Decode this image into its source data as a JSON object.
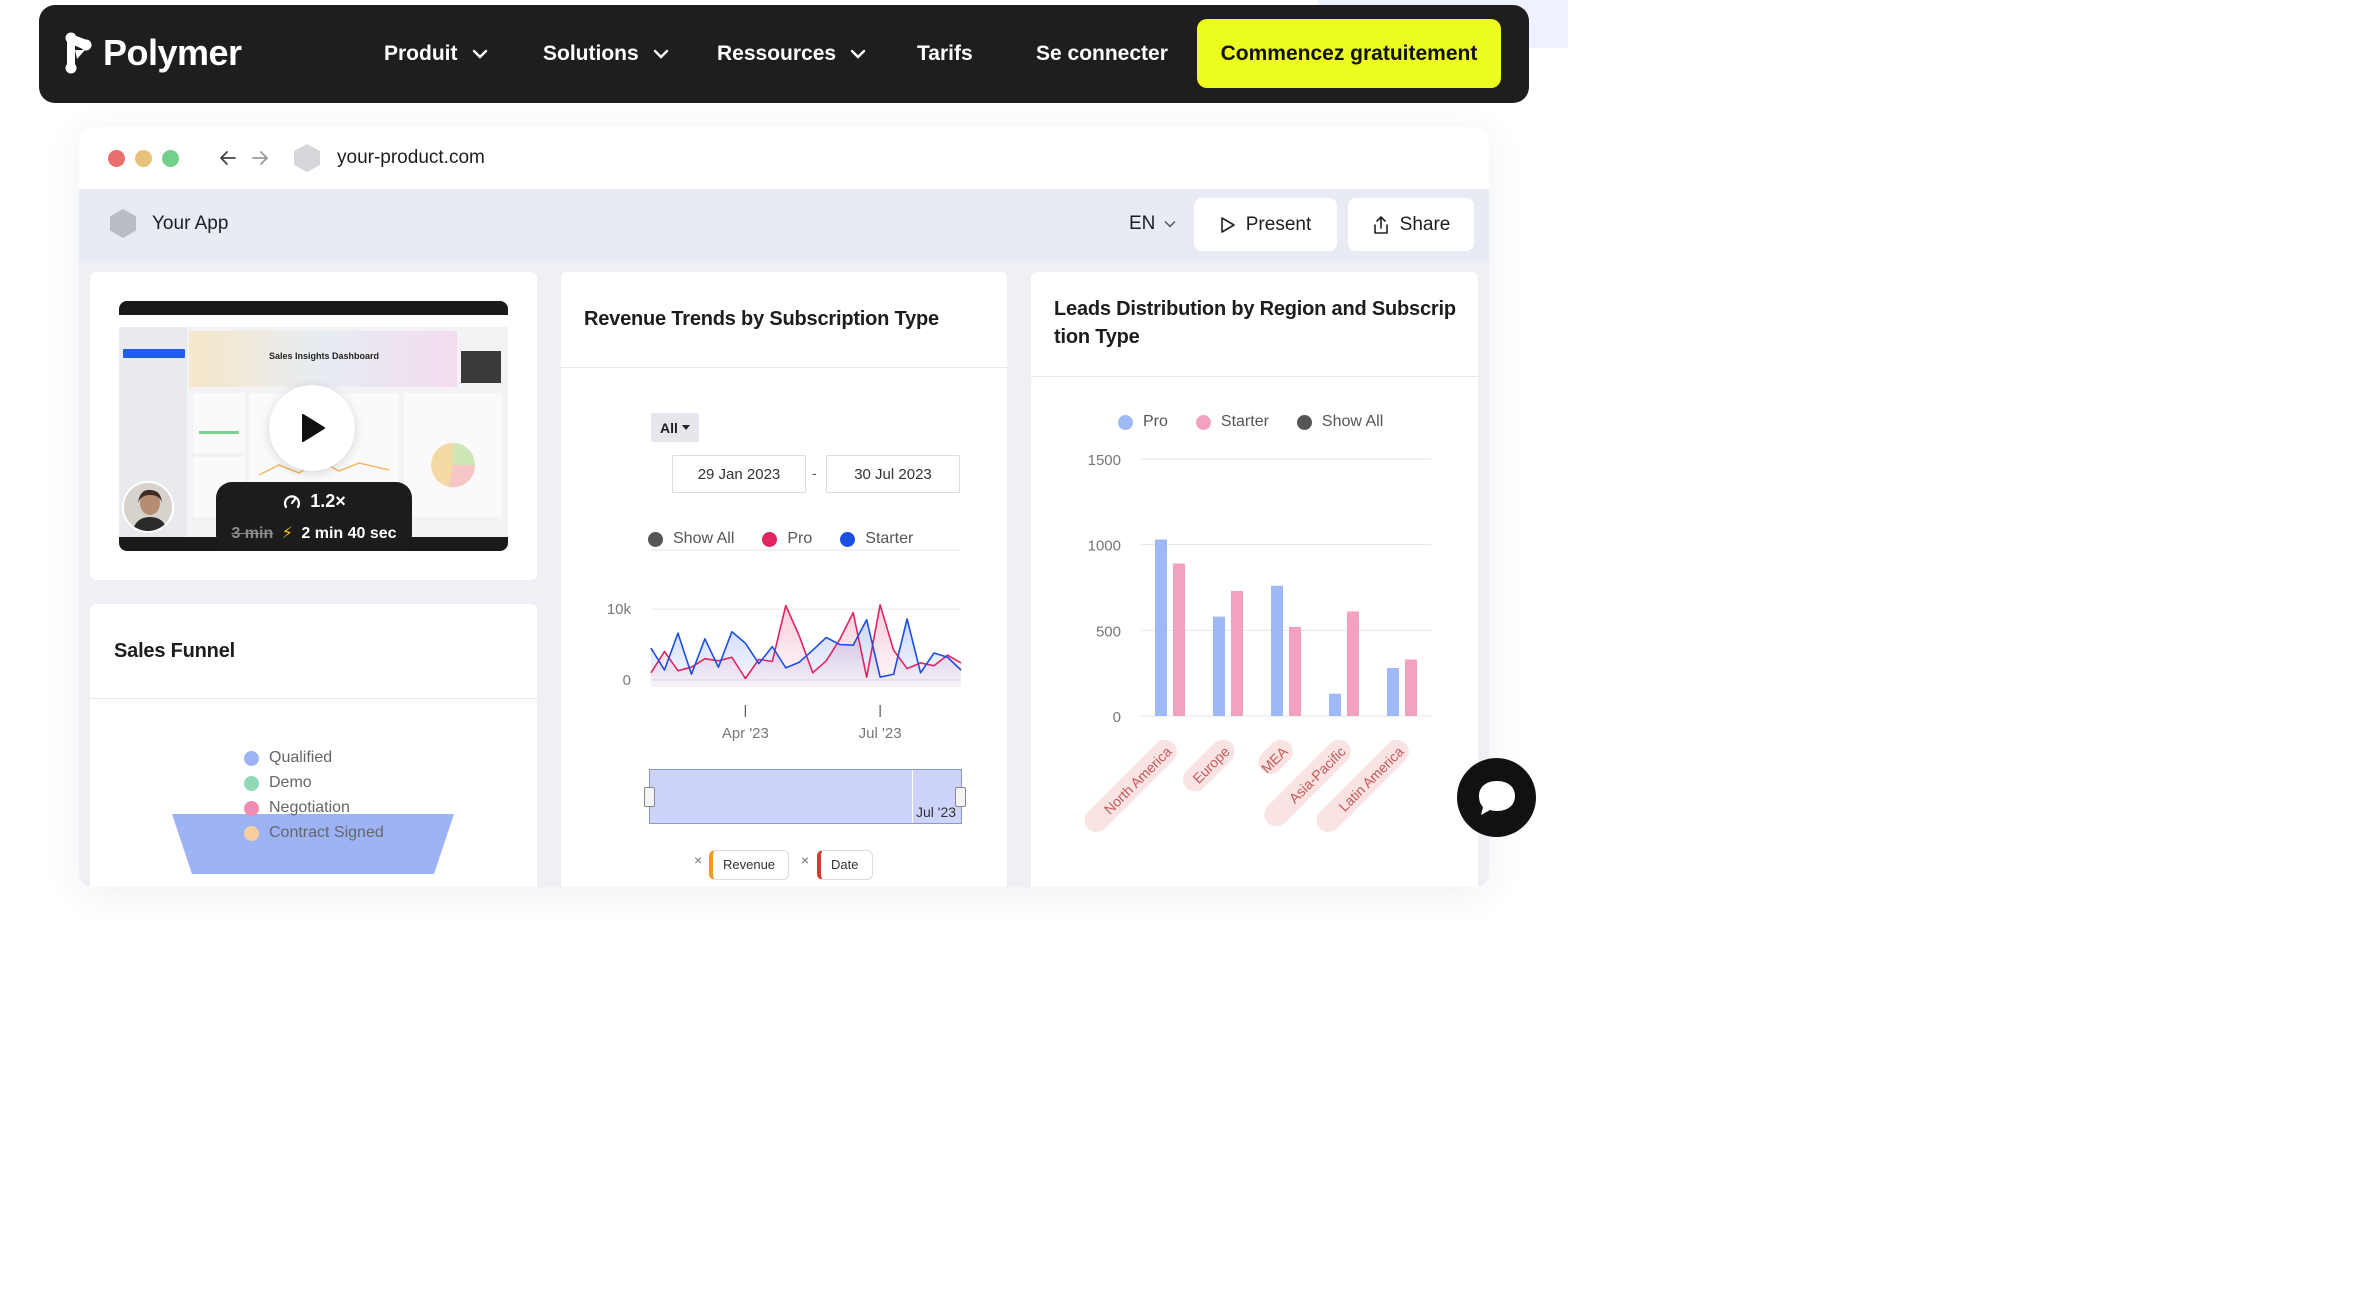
{
  "nav": {
    "brand": "Polymer",
    "items": [
      {
        "label": "Produit",
        "dropdown": true
      },
      {
        "label": "Solutions",
        "dropdown": true
      },
      {
        "label": "Ressources",
        "dropdown": true
      },
      {
        "label": "Tarifs",
        "dropdown": false
      },
      {
        "label": "Se connecter",
        "dropdown": false
      }
    ],
    "cta": "Commencez gratuitement"
  },
  "browser": {
    "url": "your-product.com"
  },
  "app": {
    "name": "Your App",
    "language": "EN",
    "present_label": "Present",
    "share_label": "Share"
  },
  "video": {
    "thumbnail_title": "Sales Insights Dashboard",
    "speed": "1.2×",
    "original_duration": "3 min",
    "new_duration": "2 min 40 sec"
  },
  "revenue_card": {
    "title": "Revenue Trends by Subscription Type",
    "filter_value": "All",
    "date_from": "29 Jan 2023",
    "date_separator": "-",
    "date_to": "30 Jul 2023",
    "range_label": "Jul '23",
    "chip_labels": [
      "Revenue",
      "Date"
    ]
  },
  "leads_card": {
    "title_line1": "Leads Distribution by Region and Subscrip",
    "title_line2": "tion Type"
  },
  "funnel_card": {
    "title": "Sales Funnel",
    "legend": [
      {
        "label": "Qualified",
        "color": "#9db3f5"
      },
      {
        "label": "Demo",
        "color": "#8fd9b6"
      },
      {
        "label": "Negotiation",
        "color": "#f08bb4"
      },
      {
        "label": "Contract Signed",
        "color": "#f6cf9c"
      }
    ],
    "funnel_color": "#9db3f5"
  },
  "colors": {
    "nav_bg": "#1e1e1e",
    "cta_bg": "#ecfc1f",
    "pro": "#e0245e",
    "starter": "#1a4fe0",
    "show_all": "#555555",
    "bar_pro": "#9fb9f7",
    "bar_starter": "#f2a2c0"
  },
  "chart_data": [
    {
      "type": "line",
      "title": "Revenue Trends by Subscription Type",
      "legend": [
        "Show All",
        "Pro",
        "Starter"
      ],
      "legend_colors": [
        "#555555",
        "#e0245e",
        "#1a4fe0"
      ],
      "y_ticks": [
        "10k",
        "0"
      ],
      "ylim": [
        -1000,
        11000
      ],
      "x_ticks": [
        {
          "label": "Apr '23",
          "index": 7
        },
        {
          "label": "Jul '23",
          "index": 17
        }
      ],
      "series": [
        {
          "name": "Pro",
          "color": "#e0245e",
          "values": [
            1000,
            4000,
            1300,
            1800,
            3000,
            2700,
            3200,
            200,
            2900,
            2600,
            10500,
            6200,
            1000,
            2700,
            5700,
            9500,
            400,
            10600,
            4200,
            1600,
            2400,
            2000,
            3500,
            2400
          ]
        },
        {
          "name": "Starter",
          "color": "#1a4fe0",
          "values": [
            4500,
            1400,
            6600,
            800,
            5800,
            1800,
            6800,
            5200,
            2300,
            4700,
            1700,
            2500,
            4200,
            6000,
            5000,
            4900,
            8500,
            400,
            800,
            8600,
            1000,
            3800,
            3200,
            1400
          ]
        }
      ]
    },
    {
      "type": "bar",
      "title": "Leads Distribution by Region and Subscription Type",
      "legend": [
        "Pro",
        "Starter",
        "Show All"
      ],
      "legend_colors": [
        "#9fb9f7",
        "#f2a2c0",
        "#555555"
      ],
      "categories": [
        "North America",
        "Europe",
        "MEA",
        "Asia-Pacific",
        "Latin America"
      ],
      "series": [
        {
          "name": "Pro",
          "color": "#9fb9f7",
          "values": [
            1030,
            580,
            760,
            130,
            280
          ]
        },
        {
          "name": "Starter",
          "color": "#f2a2c0",
          "values": [
            890,
            730,
            520,
            610,
            330
          ]
        }
      ],
      "y_ticks": [
        0,
        500,
        1000,
        1500
      ],
      "ylim": [
        0,
        1500
      ]
    }
  ]
}
